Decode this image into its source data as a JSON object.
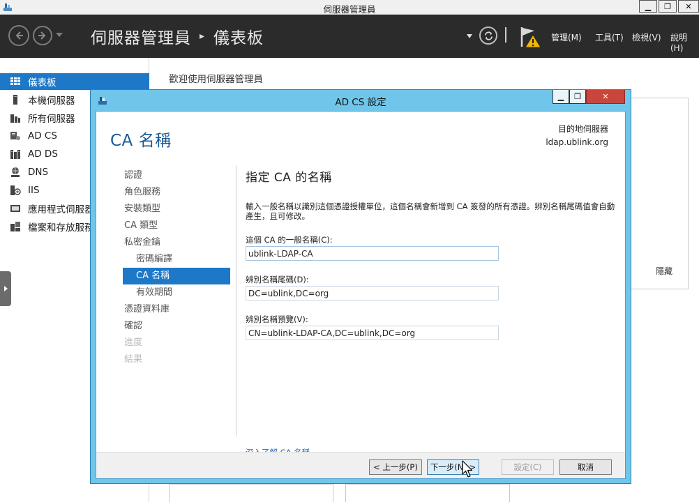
{
  "window": {
    "title": "伺服器管理員",
    "buttons": {
      "minimize": "▁",
      "restore": "❐",
      "close": "✕"
    }
  },
  "toolbar": {
    "breadcrumb_root": "伺服器管理員",
    "breadcrumb_separator": "▸",
    "breadcrumb_current": "儀表板",
    "menus": [
      "管理(M)",
      "工具(T)",
      "檢視(V)",
      "說明(H)"
    ]
  },
  "sidebar": {
    "items": [
      {
        "label": "儀表板",
        "icon": "dashboard-icon"
      },
      {
        "label": "本機伺服器",
        "icon": "server-icon"
      },
      {
        "label": "所有伺服器",
        "icon": "servers-icon"
      },
      {
        "label": "AD CS",
        "icon": "certificate-icon"
      },
      {
        "label": "AD DS",
        "icon": "directory-icon"
      },
      {
        "label": "DNS",
        "icon": "dns-icon"
      },
      {
        "label": "IIS",
        "icon": "iis-icon"
      },
      {
        "label": "應用程式伺服器",
        "icon": "app-server-icon"
      },
      {
        "label": "檔案和存放服務",
        "icon": "file-storage-icon"
      }
    ]
  },
  "main": {
    "welcome": "歡迎使用伺服器管理員",
    "hide_label": "隱藏"
  },
  "dialog": {
    "title": "AD CS 設定",
    "heading": "CA 名稱",
    "destination_label": "目的地伺服器",
    "destination_server": "ldap.ublink.org",
    "steps": [
      {
        "label": "認證",
        "state": "normal"
      },
      {
        "label": "角色服務",
        "state": "normal"
      },
      {
        "label": "安裝類型",
        "state": "normal"
      },
      {
        "label": "CA 類型",
        "state": "normal"
      },
      {
        "label": "私密金鑰",
        "state": "normal"
      },
      {
        "label": "密碼編譯",
        "state": "sub"
      },
      {
        "label": "CA 名稱",
        "state": "selected"
      },
      {
        "label": "有效期間",
        "state": "sub"
      },
      {
        "label": "憑證資料庫",
        "state": "normal"
      },
      {
        "label": "確認",
        "state": "normal"
      },
      {
        "label": "進度",
        "state": "disabled"
      },
      {
        "label": "結果",
        "state": "disabled"
      }
    ],
    "pane_title": "指定 CA 的名稱",
    "description": "輸入一般名稱以識別這個憑證授權單位，這個名稱會新增到 CA 簽發的所有憑證。辨別名稱尾碼值會自動產生，且可修改。",
    "fields": {
      "common_name_label": "這個 CA 的一般名稱(C):",
      "common_name_value": "ublink-LDAP-CA",
      "dn_suffix_label": "辨別名稱尾碼(D):",
      "dn_suffix_value": "DC=ublink,DC=org",
      "dn_preview_label": "辨別名稱預覽(V):",
      "dn_preview_value": "CN=ublink-LDAP-CA,DC=ublink,DC=org"
    },
    "learn_more": "深入了解 CA 名稱",
    "buttons": {
      "previous": "< 上一步(P)",
      "next": "下一步(N) >",
      "configure": "設定(C)",
      "cancel": "取消"
    }
  },
  "colors": {
    "toolbar_bg": "#2b2b2b",
    "selection_blue": "#1e78c8",
    "dialog_frame": "#6fc5ea",
    "heading_blue": "#1a5a96",
    "close_red": "#c9463d",
    "warning_yellow": "#f2b705"
  }
}
